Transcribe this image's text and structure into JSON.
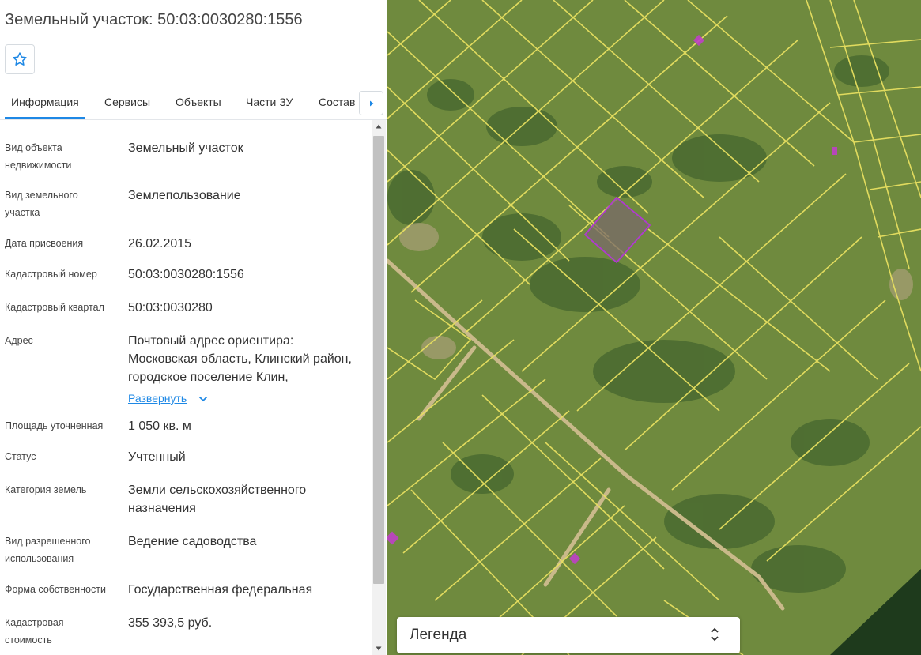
{
  "panel": {
    "title": "Земельный участок: 50:03:0030280:1556",
    "favorite_icon": "star-outline-icon",
    "tabs": [
      {
        "label": "Информация",
        "active": true
      },
      {
        "label": "Сервисы",
        "active": false
      },
      {
        "label": "Объекты",
        "active": false
      },
      {
        "label": "Части ЗУ",
        "active": false
      },
      {
        "label": "Состав",
        "active": false
      }
    ],
    "tabs_next_icon": "caret-right-icon",
    "expand_label": "Развернуть",
    "rows": [
      {
        "label": "Вид объекта недвижимости",
        "value": "Земельный участок"
      },
      {
        "label": "Вид земельного участка",
        "value": "Землепользование"
      },
      {
        "label": "Дата присвоения",
        "value": "26.02.2015"
      },
      {
        "label": "Кадастровый номер",
        "value": "50:03:0030280:1556"
      },
      {
        "label": "Кадастровый квартал",
        "value": "50:03:0030280"
      },
      {
        "label": "Адрес",
        "value": "Почтовый адрес ориентира: Московская область, Клинский район, городское поселение Клин,"
      },
      {
        "label": "Площадь уточненная",
        "value": "1 050 кв. м"
      },
      {
        "label": "Статус",
        "value": "Учтенный"
      },
      {
        "label": "Категория земель",
        "value": "Земли сельскохозяйственного назначения"
      },
      {
        "label": "Вид разрешенного использования",
        "value": "Ведение садоводства"
      },
      {
        "label": "Форма собственности",
        "value": "Государственная федеральная"
      },
      {
        "label": "Кадастровая стоимость",
        "value": "355 393,5 руб."
      }
    ]
  },
  "map": {
    "legend_label": "Легенда",
    "legend_toggle_icon": "chevron-up-down-icon",
    "colors": {
      "background": "#6f8a3e",
      "parcel_lines": "#e8e060",
      "selected_parcel_stroke": "#b03ad0",
      "selected_parcel_fill": "#7a6a6a",
      "road": "#c9b98a",
      "forest": "#3f5a2a",
      "marker": "#c040c8"
    }
  }
}
